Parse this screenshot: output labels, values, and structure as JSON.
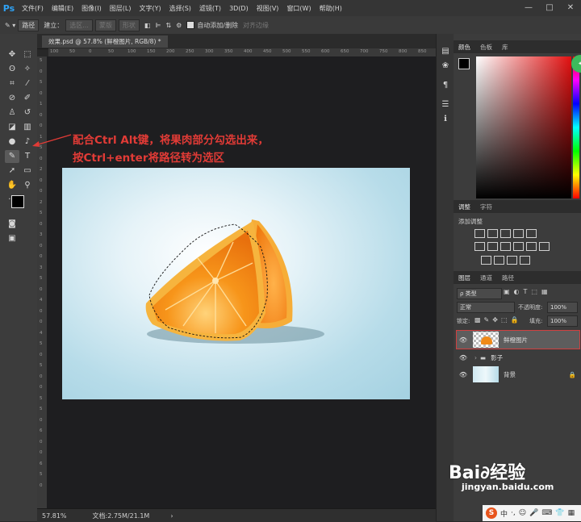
{
  "app": {
    "logo": "Ps",
    "menu": [
      "文件(F)",
      "编辑(E)",
      "图像(I)",
      "图层(L)",
      "文字(Y)",
      "选择(S)",
      "滤镜(T)",
      "3D(D)",
      "视图(V)",
      "窗口(W)",
      "帮助(H)"
    ],
    "window_controls": [
      "—",
      "□",
      "✕"
    ]
  },
  "options": {
    "mode": "路径",
    "build_label": "建立：",
    "selection_btn": "选区...",
    "mask_btn": "蒙版",
    "shape_btn": "形状",
    "auto_add_delete": "自动添加/删除",
    "align_edges": "对齐边缘"
  },
  "document": {
    "tab": "效果.psd @ 57.8% (鲜橙图片, RGB/8) *",
    "zoom": "57.81%",
    "doc_size": "文档:2.75M/21.1M"
  },
  "ruler": {
    "top": [
      "100",
      "50",
      "0",
      "50",
      "100",
      "150",
      "200",
      "250",
      "300",
      "350",
      "400",
      "450",
      "500",
      "550",
      "600",
      "650",
      "700",
      "750",
      "800",
      "850"
    ],
    "left": [
      "5",
      "0",
      "5",
      "0",
      "1",
      "0",
      "0",
      "1",
      "5",
      "0",
      "2",
      "0",
      "0",
      "2",
      "5",
      "0",
      "3",
      "0",
      "0",
      "3",
      "5",
      "0",
      "4",
      "0",
      "0",
      "4",
      "5",
      "0",
      "5",
      "0",
      "0",
      "5",
      "5",
      "0",
      "6",
      "0",
      "0",
      "6",
      "5",
      "0"
    ]
  },
  "annotation": {
    "line1": "配合Ctrl Alt键，将果肉部分勾选出来，",
    "line2": "按Ctrl+enter将路径转为选区"
  },
  "panels": {
    "color_tabs": [
      "颜色",
      "色板",
      "库"
    ],
    "adjust_tabs": [
      "调整",
      "字符"
    ],
    "add_adjustment": "添加调整",
    "layers_tabs": [
      "图层",
      "通道",
      "路径"
    ],
    "filter_kind": "ρ 类型",
    "blend_mode": "正常",
    "opacity_label": "不透明度:",
    "opacity_value": "100%",
    "lock_label": "锁定:",
    "fill_label": "填充:",
    "fill_value": "100%",
    "layers": [
      {
        "name": "鲜橙图片"
      },
      {
        "name": "影子"
      },
      {
        "name": "背景"
      }
    ]
  },
  "watermark": {
    "brand": "Bai∂经验",
    "url": "jingyan.baidu.com"
  },
  "ime": {
    "label": "中"
  },
  "colors": {
    "accent": "#e23b36",
    "ps_blue": "#2fa3f6",
    "orange": "#f28a14"
  }
}
